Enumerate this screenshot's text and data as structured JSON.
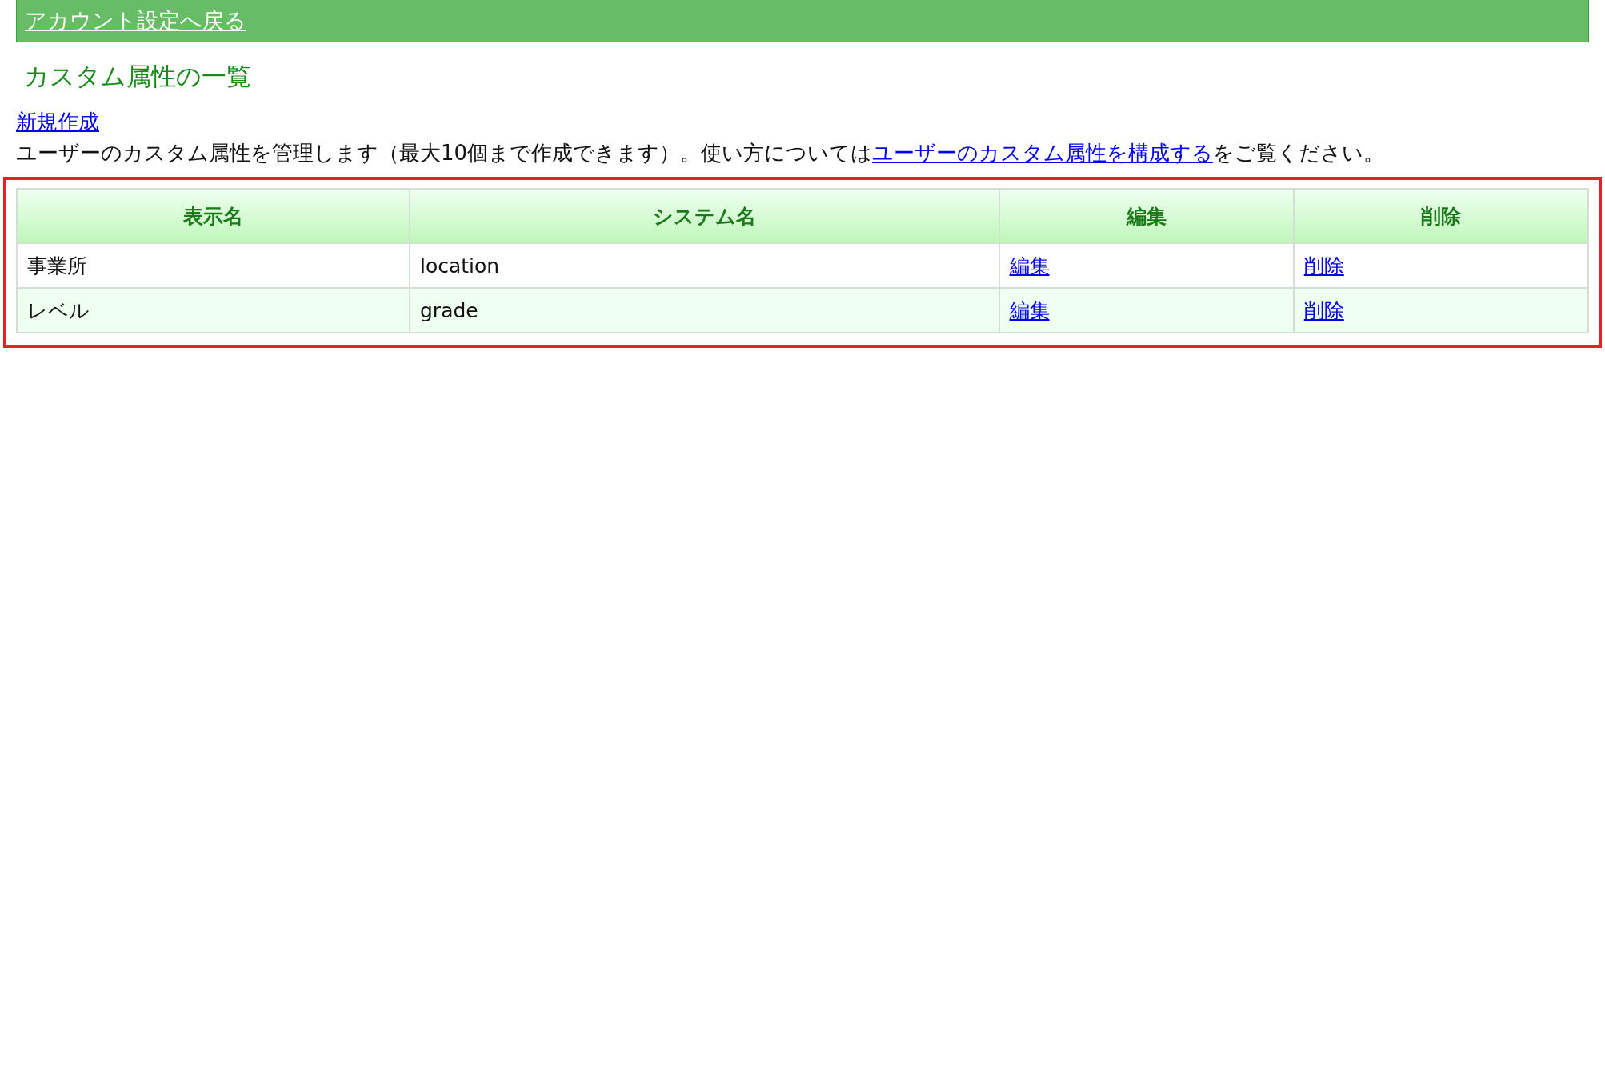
{
  "back_link": "アカウント設定へ戻る",
  "heading": "カスタム属性の一覧",
  "new_link": "新規作成",
  "description": {
    "before": "ユーザーのカスタム属性を管理します（最大10個まで作成できます）。使い方については",
    "link": "ユーザーのカスタム属性を構成する",
    "after": "をご覧ください。"
  },
  "table": {
    "highlighted": true,
    "columns": [
      "表示名",
      "システム名",
      "編集",
      "削除"
    ],
    "rows": [
      {
        "display_name": "事業所",
        "system_name": "location",
        "edit": "編集",
        "delete": "削除"
      },
      {
        "display_name": "レベル",
        "system_name": "grade",
        "edit": "編集",
        "delete": "削除"
      }
    ]
  }
}
